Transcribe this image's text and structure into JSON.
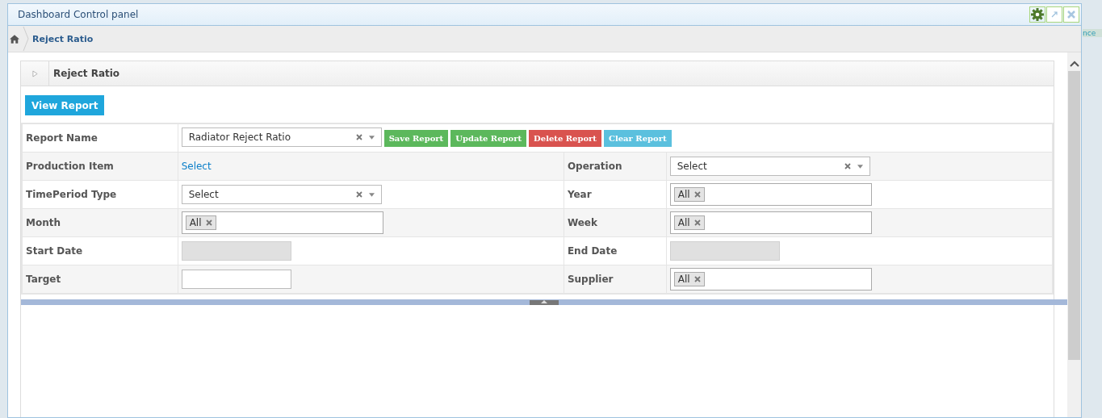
{
  "window": {
    "title": "Dashboard Control panel"
  },
  "background_text": "nce",
  "breadcrumb": [
    "Reject Ratio"
  ],
  "panel": {
    "title": "Reject Ratio",
    "expanded": false
  },
  "view_button": "View Report",
  "report_row": {
    "label": "Report Name",
    "field": {
      "value": "Radiator Reject Ratio"
    },
    "buttons": [
      {
        "label": "Save Report",
        "color": "#5cb85c"
      },
      {
        "label": "Update Report",
        "color": "#5cb85c"
      },
      {
        "label": "Delete Report",
        "color": "#d9534f"
      },
      {
        "label": "Clear Report",
        "color": "#5bc0de"
      }
    ]
  },
  "rows": [
    {
      "fields": [
        {
          "label": "Production Item",
          "kind": "link",
          "value": "Select"
        },
        {
          "label": "Operation",
          "kind": "select",
          "value": "Select"
        }
      ]
    },
    {
      "fields": [
        {
          "label": "TimePeriod Type",
          "kind": "select",
          "value": "Select"
        },
        {
          "label": "Year",
          "kind": "tags",
          "tags": [
            "All"
          ]
        }
      ]
    },
    {
      "fields": [
        {
          "label": "Month",
          "kind": "tags",
          "tags": [
            "All"
          ]
        },
        {
          "label": "Week",
          "kind": "tags",
          "tags": [
            "All"
          ]
        }
      ]
    },
    {
      "fields": [
        {
          "label": "Start Date",
          "kind": "date",
          "disabled": true
        },
        {
          "label": "End Date",
          "kind": "date",
          "disabled": true
        }
      ]
    },
    {
      "fields": [
        {
          "label": "Target",
          "kind": "input",
          "disabled": false
        },
        {
          "label": "Supplier",
          "kind": "tags",
          "tags": [
            "All"
          ]
        }
      ]
    }
  ]
}
